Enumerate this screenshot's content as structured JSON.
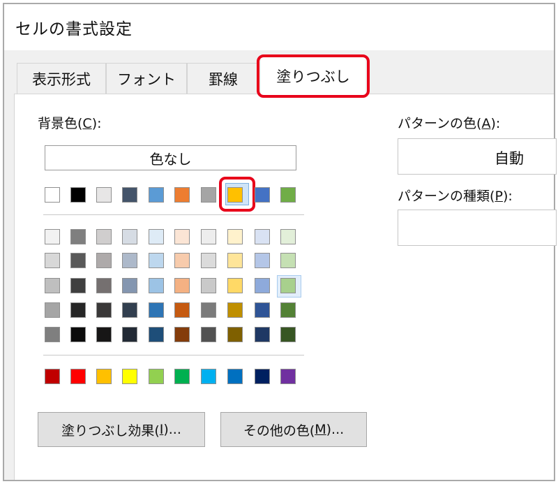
{
  "window": {
    "title": "セルの書式設定"
  },
  "tabs": [
    {
      "label": "表示形式"
    },
    {
      "label": "フォント"
    },
    {
      "label": "罫線"
    },
    {
      "label": "塗りつぶし",
      "active": true
    }
  ],
  "background": {
    "label_prefix": "背景色(",
    "label_key": "C",
    "label_suffix": "):",
    "no_color_button": "色なし",
    "selected_color": "#ffc000"
  },
  "palette": {
    "theme_base": [
      "#ffffff",
      "#000000",
      "#e7e6e6",
      "#44546a",
      "#5b9bd5",
      "#ed7d31",
      "#a5a5a5",
      "#ffc000",
      "#4472c4",
      "#70ad47"
    ],
    "theme_tints": [
      [
        "#f2f2f2",
        "#7f7f7f",
        "#d0cece",
        "#d6dce4",
        "#deebf6",
        "#fbe5d5",
        "#ededed",
        "#fff2cc",
        "#d9e2f3",
        "#e2efd9"
      ],
      [
        "#d8d8d8",
        "#595959",
        "#aeaaaa",
        "#adb9ca",
        "#bdd7ee",
        "#f7cbac",
        "#dbdbdb",
        "#fee599",
        "#b4c6e7",
        "#c5e0b3"
      ],
      [
        "#bfbfbf",
        "#3f3f3f",
        "#757070",
        "#8496b0",
        "#9cc3e5",
        "#f4b183",
        "#c9c9c9",
        "#ffd966",
        "#8eaadb",
        "#a8d08d"
      ],
      [
        "#a5a5a5",
        "#262626",
        "#3a3838",
        "#323f4f",
        "#2e75b5",
        "#c55a11",
        "#7b7b7b",
        "#bf8f00",
        "#2f5496",
        "#538135"
      ],
      [
        "#7f7f7f",
        "#0c0c0c",
        "#171616",
        "#222a35",
        "#1e4e79",
        "#843c0b",
        "#525252",
        "#7f6000",
        "#1f3864",
        "#375623"
      ]
    ],
    "standard": [
      "#c00000",
      "#ff0000",
      "#ffc000",
      "#ffff00",
      "#92d050",
      "#00b050",
      "#00b0f0",
      "#0070c0",
      "#002060",
      "#7030a0"
    ]
  },
  "buttons": {
    "fill_effects": {
      "prefix": "塗りつぶし効果(",
      "key": "I",
      "suffix": ")..."
    },
    "more_colors": {
      "prefix": "その他の色(",
      "key": "M",
      "suffix": ")..."
    }
  },
  "pattern_color": {
    "label_prefix": "パターンの色(",
    "label_key": "A",
    "label_suffix": "):",
    "value": "自動"
  },
  "pattern_style": {
    "label_prefix": "パターンの種類(",
    "label_key": "P",
    "label_suffix": "):",
    "value": ""
  }
}
